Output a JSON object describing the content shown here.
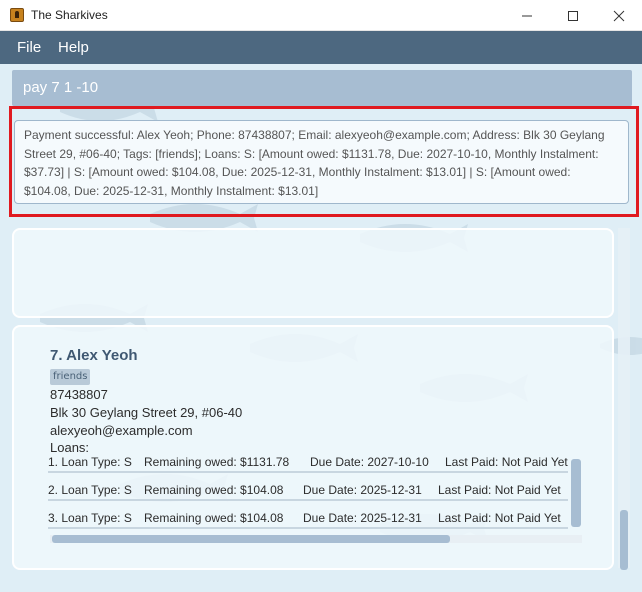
{
  "window": {
    "title": "The Sharkives",
    "minimize_icon": "minimize-icon",
    "maximize_icon": "maximize-icon",
    "close_icon": "close-icon"
  },
  "menu": {
    "items": [
      "File",
      "Help"
    ]
  },
  "command": {
    "text": "pay 7 1 -10"
  },
  "result": {
    "text": "Payment successful: Alex Yeoh; Phone: 87438807; Email: alexyeoh@example.com; Address: Blk 30 Geylang Street 29, #06-40; Tags: [friends]; Loans: S: [Amount owed: $1131.78, Due: 2027-10-10, Monthly Instalment: $37.73]  | S: [Amount owed: $104.08, Due: 2025-12-31, Monthly Instalment: $13.01]  | S: [Amount owed: $104.08, Due: 2025-12-31, Monthly Instalment: $13.01]"
  },
  "person": {
    "index_name": "7.  Alex Yeoh",
    "tag": "friends",
    "phone": "87438807",
    "address": "Blk 30 Geylang Street 29, #06-40",
    "email": "alexyeoh@example.com",
    "loans_label": "Loans:",
    "loans": [
      {
        "num": "1. Loan Type: S",
        "remaining": "Remaining owed: $1131.78",
        "due": "Due Date: 2027-10-10",
        "paid": "Last Paid: Not Paid Yet"
      },
      {
        "num": "2. Loan Type: S",
        "remaining": "Remaining owed: $104.08",
        "due": "Due Date: 2025-12-31",
        "paid": "Last Paid: Not Paid Yet"
      },
      {
        "num": "3. Loan Type: S",
        "remaining": "Remaining owed: $104.08",
        "due": "Due Date: 2025-12-31",
        "paid": "Last Paid: Not Paid Yet"
      }
    ]
  },
  "colors": {
    "menubar": "#4d6880",
    "accent": "#a7bdd2",
    "highlight": "#e0191f",
    "background": "#dfeef6"
  }
}
